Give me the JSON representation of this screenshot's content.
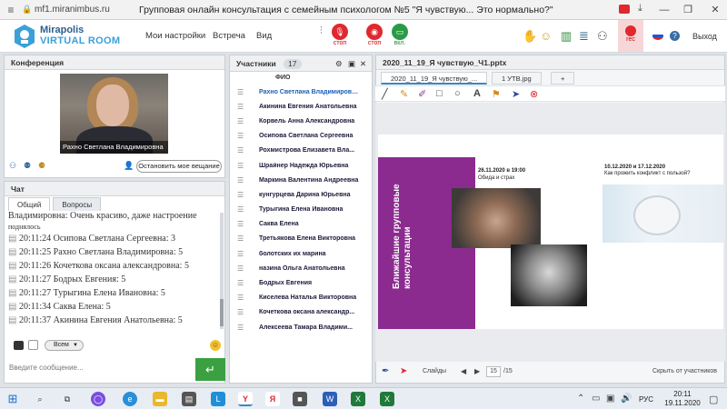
{
  "browser": {
    "url": "mf1.miranimbus.ru",
    "title": "Групповая онлайн консультация с семейным психологом №5 \"Я чувствую... Это нормально?\"",
    "win_min": "—",
    "win_max": "❐",
    "win_close": "✕"
  },
  "header": {
    "logo_line1": "Mirapolis",
    "logo_line2": "VIRTUAL ROOM",
    "menu": [
      "Мои настройки",
      "Встреча",
      "Вид"
    ],
    "mic_label": "стоп",
    "cam_label": "стоп",
    "share_label": "вкл.",
    "rec_label": "rec",
    "exit_label": "Выход"
  },
  "conference": {
    "title": "Конференция",
    "video_caption": "Рахно Светлана  Владимировна",
    "stop_broadcast": "Остановить мое вещание"
  },
  "chat": {
    "title": "Чат",
    "tabs": [
      "Общий",
      "Вопросы"
    ],
    "first_line": "Владимировна: Очень красиво, даже настроение",
    "first_line2": "поднялось",
    "messages": [
      "20:11:24 Осипова  Светлана Сергеевна: 3",
      "20:11:25 Рахно Светлана  Владимировна: 5",
      "20:11:26 Кочеткова  оксана александровна: 5",
      "20:11:27 Бодрых  Евгения: 5",
      "20:11:27 Турыгина  Елена  Ивановна: 5",
      "20:11:34 Саква  Елена: 5",
      "20:11:37 Акинина  Евгения  Анатольевна: 5"
    ],
    "recipient": "Всем",
    "input_placeholder": "Введите сообщение..."
  },
  "participants": {
    "title": "Участники",
    "count": "17",
    "column": "ФИО",
    "names": [
      "Рахно Светлана  Владимировна",
      "Акинина  Евгения  Анатольевна",
      "Корвель Анна  Александровна",
      "Осипова  Светлана  Сергеевна",
      "Рохмистрова  Елизавета Вла...",
      "Шрайнер Надежда  Юрьевна",
      "Маркина Валентина  Андреевна",
      "кунгурцева  Дарина  Юрьевна",
      "Турыгина  Елена  Ивановна",
      "Саква  Елена",
      "Третьякова  Елена Викторовна",
      "болотских их марина",
      "назина  Ольга Анатольевна",
      "Бодрых  Евгения",
      "Киселева  Наталья  Викторовна",
      "Кочеткова  оксана александр...",
      "Алексеева  Тамара  Владими..."
    ]
  },
  "presentation": {
    "title": "2020_11_19_Я чувствую_Ч1.pptx",
    "tabs": [
      "2020_11_19_Я чувствую_...",
      "1 УТВ.jpg"
    ],
    "add_tab": "+",
    "slide_vertical": "Ближайшие групповые консультации",
    "event1_date": "26.11.2020 в 19:00",
    "event1_title": "Обида и страх",
    "event2_date": "10.12.2020 и 17.12.2020",
    "event2_title": "Как прожить конфликт с пользой?",
    "slides_label": "Слайды",
    "page": "15",
    "total": "/15",
    "hide_participants": "Скрыть от участников"
  },
  "taskbar": {
    "lang": "РУС",
    "time": "20:11",
    "date": "19.11.2020"
  },
  "colors": {
    "accent": "#3a86c8",
    "slide_band": "#8b2b8f",
    "send_green": "#3aa041",
    "record_red": "#e0282e"
  }
}
